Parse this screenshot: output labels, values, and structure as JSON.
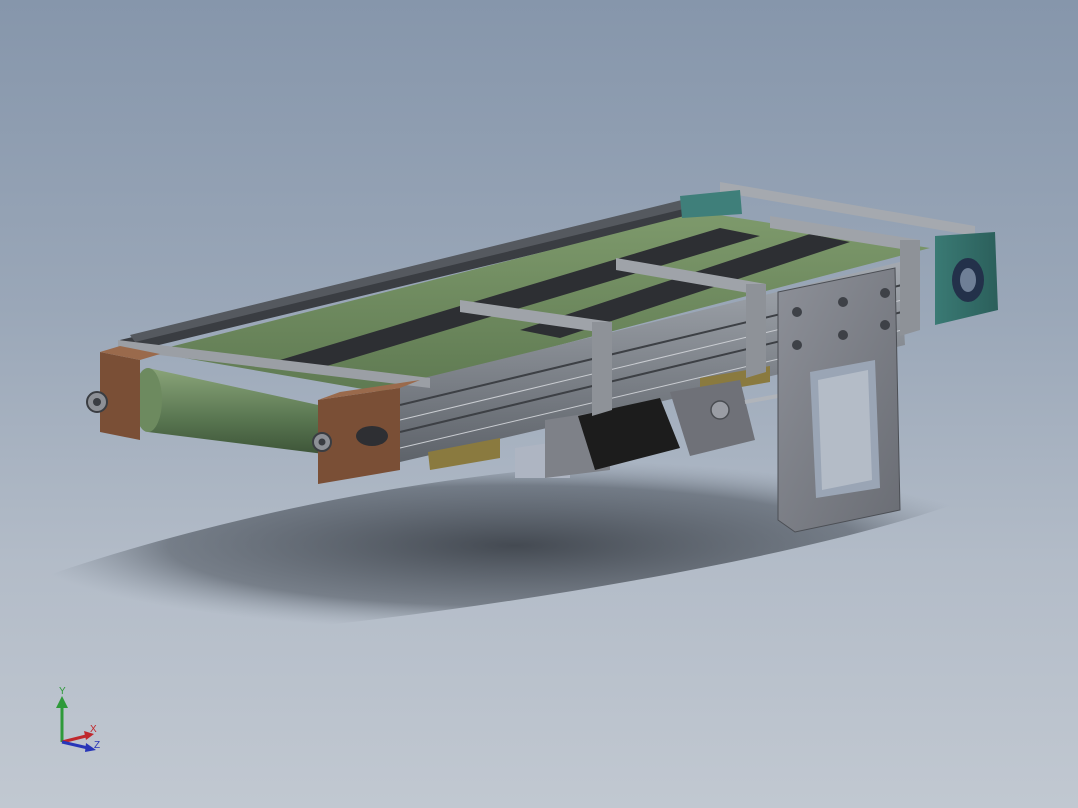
{
  "viewport": {
    "background_top": "#8696ab",
    "background_bottom": "#c1c8d1"
  },
  "triad": {
    "x_label": "X",
    "y_label": "Y",
    "z_label": "Z",
    "x_color": "#c0282d",
    "y_color": "#2f9a3a",
    "z_color": "#2836b8"
  },
  "model": {
    "belt_color": "#6f8a5f",
    "roller_color": "#587550",
    "end_block_color": "#7a4f36",
    "frame_color": "#8b8f96",
    "drive_block_color": "#3f7f7a",
    "motor_color": "#1c1c1c",
    "mount_plate_color": "#7d8088"
  }
}
